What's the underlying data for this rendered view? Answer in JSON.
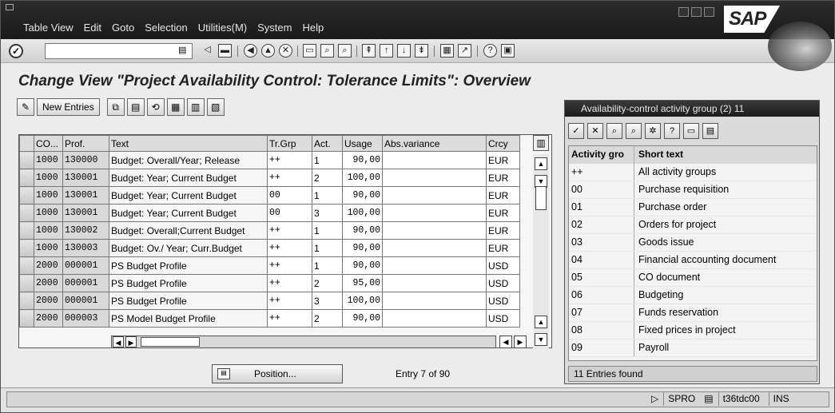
{
  "menu": [
    "Table View",
    "Edit",
    "Goto",
    "Selection",
    "Utilities(M)",
    "System",
    "Help"
  ],
  "logo_text": "SAP",
  "page_title": "Change View \"Project Availability Control: Tolerance Limits\": Overview",
  "app_toolbar": {
    "new_entries": "New Entries"
  },
  "table": {
    "headers": [
      "CO...",
      "Prof.",
      "Text",
      "Tr.Grp",
      "Act.",
      "Usage",
      "Abs.variance",
      "Crcy"
    ],
    "rows": [
      [
        "1000",
        "130000",
        "Budget: Overall/Year; Release",
        "++",
        "1",
        "90,00",
        "",
        "EUR"
      ],
      [
        "1000",
        "130001",
        "Budget: Year; Current Budget",
        "++",
        "2",
        "100,00",
        "",
        "EUR"
      ],
      [
        "1000",
        "130001",
        "Budget: Year; Current Budget",
        "00",
        "1",
        "90,00",
        "",
        "EUR"
      ],
      [
        "1000",
        "130001",
        "Budget: Year; Current Budget",
        "00",
        "3",
        "100,00",
        "",
        "EUR"
      ],
      [
        "1000",
        "130002",
        "Budget: Overall;Current Budget",
        "++",
        "1",
        "90,00",
        "",
        "EUR"
      ],
      [
        "1000",
        "130003",
        "Budget: Ov./ Year; Curr.Budget",
        "++",
        "1",
        "90,00",
        "",
        "EUR"
      ],
      [
        "2000",
        "000001",
        "PS Budget Profile",
        "++",
        "1",
        "90,00",
        "",
        "USD"
      ],
      [
        "2000",
        "000001",
        "PS Budget Profile",
        "++",
        "2",
        "95,00",
        "",
        "USD"
      ],
      [
        "2000",
        "000001",
        "PS Budget Profile",
        "++",
        "3",
        "100,00",
        "",
        "USD"
      ],
      [
        "2000",
        "000003",
        "PS Model Budget Profile",
        "++",
        "2",
        "90,00",
        "",
        "USD"
      ]
    ]
  },
  "position_button": "Position...",
  "entry_info": "Entry 7 of 90",
  "status": {
    "transaction": "SPRO",
    "server": "t36tdc00",
    "mode": "INS"
  },
  "popup": {
    "title": "Availability-control activity group (2)  11",
    "headers": [
      "Activity gro",
      "Short text"
    ],
    "rows": [
      [
        "++",
        "All activity groups"
      ],
      [
        "00",
        "Purchase requisition"
      ],
      [
        "01",
        "Purchase order"
      ],
      [
        "02",
        "Orders for project"
      ],
      [
        "03",
        "Goods issue"
      ],
      [
        "04",
        "Financial accounting document"
      ],
      [
        "05",
        "CO document"
      ],
      [
        "06",
        "Budgeting"
      ],
      [
        "07",
        "Funds reservation"
      ],
      [
        "08",
        "Fixed prices in project"
      ],
      [
        "09",
        "Payroll"
      ]
    ],
    "status": "11 Entries found"
  }
}
